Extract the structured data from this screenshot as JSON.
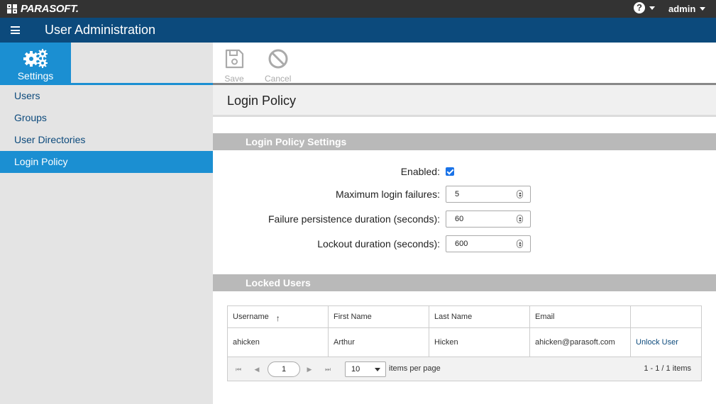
{
  "topbar": {
    "brand": "PARASOFT.",
    "user": "admin"
  },
  "header": {
    "title": "User Administration"
  },
  "sidebar": {
    "tile_label": "Settings",
    "items": [
      {
        "label": "Users"
      },
      {
        "label": "Groups"
      },
      {
        "label": "User Directories"
      },
      {
        "label": "Login Policy"
      }
    ],
    "active": "Login Policy"
  },
  "toolbar": {
    "save_label": "Save",
    "cancel_label": "Cancel"
  },
  "page": {
    "title": "Login Policy"
  },
  "settings": {
    "section_title": "Login Policy Settings",
    "enabled_label": "Enabled:",
    "enabled": true,
    "max_failures_label": "Maximum login failures:",
    "max_failures": "5",
    "failure_duration_label": "Failure persistence duration (seconds):",
    "failure_duration": "60",
    "lockout_label": "Lockout duration (seconds):",
    "lockout": "600"
  },
  "locked_users": {
    "section_title": "Locked Users",
    "columns": [
      "Username",
      "First Name",
      "Last Name",
      "Email",
      ""
    ],
    "rows": [
      {
        "username": "ahicken",
        "first": "Arthur",
        "last": "Hicken",
        "email": "ahicken@parasoft.com",
        "action": "Unlock User"
      }
    ],
    "pager": {
      "page": "1",
      "page_size": "10",
      "items_per_page_label": "items per page",
      "count": "1 - 1 / 1 items"
    }
  },
  "colors": {
    "topbar": "#333333",
    "titlebar": "#0c4a7c",
    "accent": "#1b8fd2",
    "section": "#b9b9b9"
  }
}
